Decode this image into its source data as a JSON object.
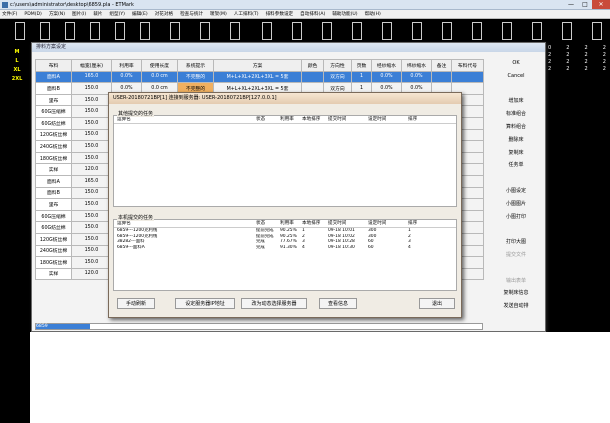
{
  "window": {
    "title": "c:\\users\\administrator\\desktop\\6859.pla - ETMark",
    "minimize": "—",
    "maximize": "□",
    "close": "✕"
  },
  "menu": [
    "文件(F)",
    "PDM(D)",
    "方案(N)",
    "图片(I)",
    "裁片",
    "组型(Y)",
    "编辑(E)",
    "对花对格",
    "检查与统计",
    "唛架(M)",
    "人工排料(T)",
    "排料参数设定",
    "自动排料(A)",
    "辅助功能(U)",
    "帮助(H)"
  ],
  "sizes": [
    "M",
    "L",
    "XL",
    "2XL"
  ],
  "right_numbers": [
    [
      "0",
      "2",
      "2",
      "2"
    ],
    [
      "2",
      "2",
      "2",
      "2"
    ],
    [
      "2",
      "2",
      "2",
      "2"
    ],
    [
      "2",
      "2",
      "2",
      "2"
    ]
  ],
  "dialog": {
    "title": "排料方案设定",
    "headers": [
      "布料",
      "幅宽(厘米)",
      "利用率",
      "使用长度",
      "系统提示",
      "方案",
      "颜色",
      "方向性",
      "页数",
      "经纱缩水",
      "纬纱缩水",
      "备注",
      "布料代号"
    ],
    "rows": [
      {
        "name": "面料A",
        "width": "165.0",
        "util": "0.0%",
        "len": "0.0 cm",
        "hint": "不完整的",
        "plan": "M+L+XL+2XL+3XL = 5套",
        "color": "",
        "dir": "双方向",
        "pages": "1",
        "warp": "0.0%",
        "weft": "0.0%",
        "note": "",
        "code": ""
      },
      {
        "name": "面料B",
        "width": "150.0",
        "util": "0.0%",
        "len": "0.0 cm",
        "hint": "不完整的",
        "plan": "M+L+XL+2XL+3XL = 5套",
        "color": "",
        "dir": "双方向",
        "pages": "1",
        "warp": "0.0%",
        "weft": "0.0%",
        "note": "",
        "code": ""
      },
      {
        "name": "里布",
        "width": "150.0",
        "util": "",
        "len": "",
        "hint": "",
        "plan": "",
        "color": "",
        "dir": "",
        "pages": "",
        "warp": "",
        "weft": "",
        "note": "",
        "code": ""
      },
      {
        "name": "60G压缩棉",
        "width": "150.0",
        "util": "",
        "len": "",
        "hint": "",
        "plan": "",
        "color": "",
        "dir": "",
        "pages": "",
        "warp": "",
        "weft": "",
        "note": "",
        "code": ""
      },
      {
        "name": "60G纺丝棉",
        "width": "150.0",
        "util": "",
        "len": "",
        "hint": "",
        "plan": "",
        "color": "",
        "dir": "",
        "pages": "",
        "warp": "",
        "weft": "",
        "note": "",
        "code": ""
      },
      {
        "name": "120G纺丝棉",
        "width": "150.0",
        "util": "",
        "len": "",
        "hint": "",
        "plan": "",
        "color": "",
        "dir": "",
        "pages": "",
        "warp": "",
        "weft": "",
        "note": "",
        "code": ""
      },
      {
        "name": "240G纺丝棉",
        "width": "150.0",
        "util": "",
        "len": "",
        "hint": "",
        "plan": "",
        "color": "",
        "dir": "",
        "pages": "",
        "warp": "",
        "weft": "",
        "note": "",
        "code": ""
      },
      {
        "name": "180G纺丝棉",
        "width": "150.0",
        "util": "",
        "len": "",
        "hint": "",
        "plan": "",
        "color": "",
        "dir": "",
        "pages": "",
        "warp": "",
        "weft": "",
        "note": "",
        "code": ""
      },
      {
        "name": "实样",
        "width": "120.0",
        "util": "",
        "len": "",
        "hint": "",
        "plan": "",
        "color": "",
        "dir": "",
        "pages": "",
        "warp": "",
        "weft": "",
        "note": "",
        "code": ""
      },
      {
        "name": "面料A",
        "width": "165.0",
        "util": "",
        "len": "",
        "hint": "",
        "plan": "",
        "color": "",
        "dir": "",
        "pages": "",
        "warp": "",
        "weft": "",
        "note": "",
        "code": ""
      },
      {
        "name": "面料B",
        "width": "150.0",
        "util": "",
        "len": "",
        "hint": "",
        "plan": "",
        "color": "",
        "dir": "",
        "pages": "",
        "warp": "",
        "weft": "",
        "note": "",
        "code": ""
      },
      {
        "name": "里布",
        "width": "150.0",
        "util": "",
        "len": "",
        "hint": "",
        "plan": "",
        "color": "",
        "dir": "",
        "pages": "",
        "warp": "",
        "weft": "",
        "note": "",
        "code": ""
      },
      {
        "name": "60G压缩棉",
        "width": "150.0",
        "util": "",
        "len": "",
        "hint": "",
        "plan": "",
        "color": "",
        "dir": "",
        "pages": "",
        "warp": "",
        "weft": "",
        "note": "",
        "code": ""
      },
      {
        "name": "60G纺丝棉",
        "width": "150.0",
        "util": "",
        "len": "",
        "hint": "",
        "plan": "",
        "color": "",
        "dir": "",
        "pages": "",
        "warp": "",
        "weft": "",
        "note": "",
        "code": ""
      },
      {
        "name": "120G纺丝棉",
        "width": "150.0",
        "util": "",
        "len": "",
        "hint": "",
        "plan": "",
        "color": "",
        "dir": "",
        "pages": "",
        "warp": "",
        "weft": "",
        "note": "",
        "code": ""
      },
      {
        "name": "240G纺丝棉",
        "width": "150.0",
        "util": "",
        "len": "",
        "hint": "",
        "plan": "",
        "color": "",
        "dir": "",
        "pages": "",
        "warp": "",
        "weft": "",
        "note": "",
        "code": ""
      },
      {
        "name": "180G纺丝棉",
        "width": "150.0",
        "util": "",
        "len": "",
        "hint": "",
        "plan": "",
        "color": "",
        "dir": "",
        "pages": "",
        "warp": "",
        "weft": "",
        "note": "",
        "code": ""
      },
      {
        "name": "实样",
        "width": "120.0",
        "util": "",
        "len": "",
        "hint": "",
        "plan": "",
        "color": "",
        "dir": "",
        "pages": "",
        "warp": "",
        "weft": "",
        "note": "",
        "code": ""
      }
    ],
    "side_buttons": [
      "OK",
      "Cancel",
      "",
      "增加床",
      "标准组合",
      "算料组合",
      "删除床",
      "复制床",
      "任务单",
      "",
      "小图设定",
      "小图图片",
      "小图打印",
      "",
      "打印大图",
      "提交文件",
      "",
      "输出表单",
      "复制床信息",
      "发送自动排"
    ],
    "progress_label": "6859",
    "progress": 0.12
  },
  "server_dialog": {
    "title": "USER-20180721BP[1] 连接到服务器: USER-20180721BP[127.0.0.1]",
    "others_label": "其他提交的任务",
    "mine_label": "本机提交的任务",
    "headers": [
      "运算名",
      "状态",
      "利用率",
      "本地排序",
      "提交时间",
      "设定时间",
      "排序"
    ],
    "jobs": [
      [
        "6859---1200克利线",
        "提前完成",
        "90.25%",
        "1",
        "09-18 10:01",
        "300",
        "1"
      ],
      [
        "6859---1200克利线",
        "提前完成",
        "90.25%",
        "2",
        "09-18 10:02",
        "300",
        "2"
      ],
      [
        "38282---面料",
        "完成",
        "77.67%",
        "3",
        "09-18 10:28",
        "60",
        "3"
      ],
      [
        "6859---面料A",
        "完成",
        "91.30%",
        "4",
        "09-18 10:30",
        "60",
        "4"
      ]
    ],
    "buttons": [
      "手动刷新",
      "设定服务器IP地址",
      "改为动态选择服务器",
      "查看信息",
      "退出"
    ]
  },
  "status": {
    "coordinate": "1(0.0 cm)"
  }
}
